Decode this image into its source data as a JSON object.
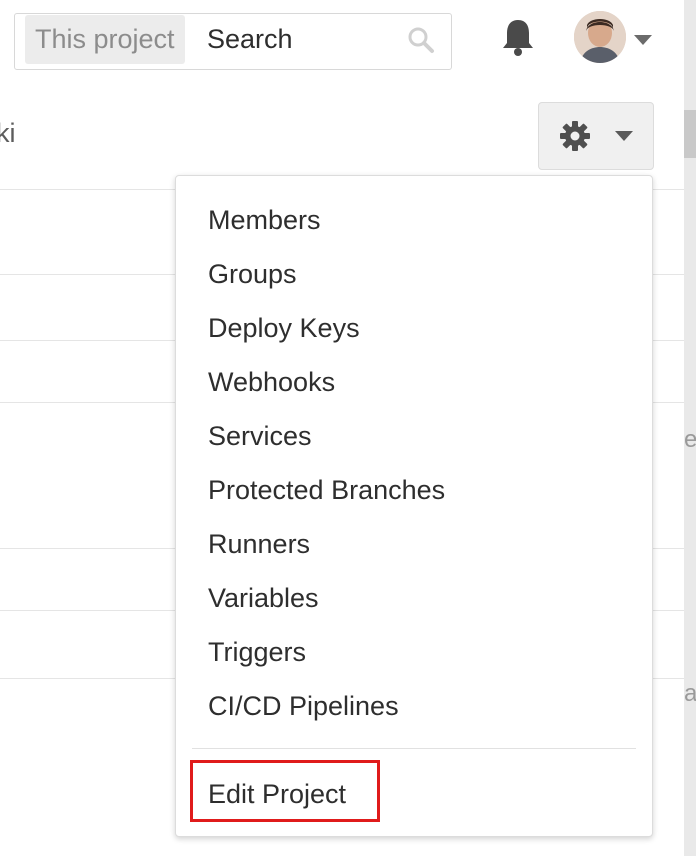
{
  "header": {
    "search": {
      "scope_label": "This project",
      "placeholder": "Search"
    }
  },
  "subnav": {
    "partial_tab": "iki"
  },
  "settings_menu": {
    "items": [
      "Members",
      "Groups",
      "Deploy Keys",
      "Webhooks",
      "Services",
      "Protected Branches",
      "Runners",
      "Variables",
      "Triggers",
      "CI/CD Pipelines"
    ],
    "edit_project": "Edit Project"
  },
  "edge_fragments": {
    "e": "e",
    "ar": "ar"
  },
  "colors": {
    "highlight": "#e01b1b"
  }
}
